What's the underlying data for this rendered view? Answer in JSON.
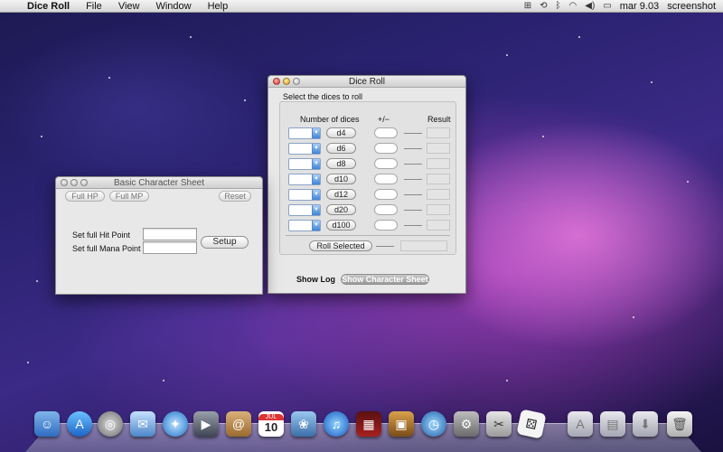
{
  "menubar": {
    "app_name": "Dice Roll",
    "menus": [
      "File",
      "View",
      "Window",
      "Help"
    ],
    "clock": "mar 9.03",
    "user": "screenshot"
  },
  "dice_window": {
    "title": "Dice Roll",
    "instruction": "Select the dices to roll",
    "col_number": "Number of dices",
    "col_modifier": "+/−",
    "col_result": "Result",
    "dice": [
      "d4",
      "d6",
      "d8",
      "d10",
      "d12",
      "d20",
      "d100"
    ],
    "roll_selected": "Roll Selected",
    "show_log": "Show Log",
    "show_sheet": "Show Character Sheet"
  },
  "char_window": {
    "title": "Basic Character Sheet",
    "full_hp": "Full HP",
    "full_mp": "Full MP",
    "reset": "Reset",
    "hp_label": "Set full Hit Point",
    "mp_label": "Set full Mana Point",
    "setup": "Setup"
  },
  "dock": {
    "calendar_month": "JUL",
    "calendar_day": "10"
  },
  "colors": {
    "accent_blue": "#3d85d8",
    "wallpaper_magenta": "#c050c8"
  }
}
